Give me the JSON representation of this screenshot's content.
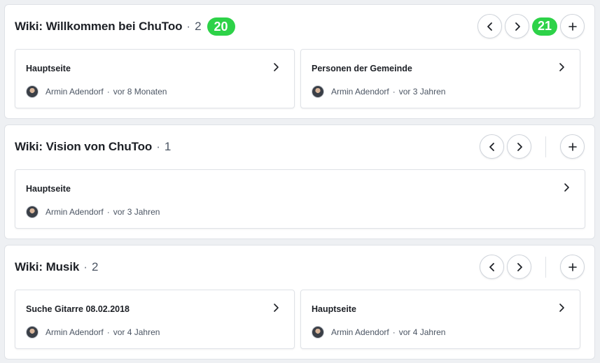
{
  "sections": [
    {
      "title": "Wiki: Willkommen bei ChuToo",
      "dot": "·",
      "count": "2",
      "badge": "20",
      "control_badge": "21",
      "cards": [
        {
          "title": "Hauptseite",
          "author": "Armin Adendorf",
          "time": "vor 8 Monaten"
        },
        {
          "title": "Personen der Gemeinde",
          "author": "Armin Adendorf",
          "time": "vor 3 Jahren"
        }
      ]
    },
    {
      "title": "Wiki: Vision von ChuToo",
      "dot": "·",
      "count": "1",
      "cards": [
        {
          "title": "Hauptseite",
          "author": "Armin Adendorf",
          "time": "vor 3 Jahren"
        }
      ]
    },
    {
      "title": "Wiki: Musik",
      "dot": "·",
      "count": "2",
      "cards": [
        {
          "title": "Suche Gitarre 08.02.2018",
          "author": "Armin Adendorf",
          "time": "vor 4 Jahren"
        },
        {
          "title": "Hauptseite",
          "author": "Armin Adendorf",
          "time": "vor 4 Jahren"
        }
      ]
    }
  ],
  "meta_separator": "·",
  "icons": {
    "prev": "chevron-left-icon",
    "next": "chevron-right-icon",
    "add": "plus-icon",
    "card": "chevron-right-icon",
    "avatar": "user-avatar"
  },
  "colors": {
    "badge_green": "#2dd248",
    "text_dark": "#1d2026",
    "text_muted": "#4b5563",
    "border": "#dfe2e7",
    "background": "#eef0f3"
  }
}
